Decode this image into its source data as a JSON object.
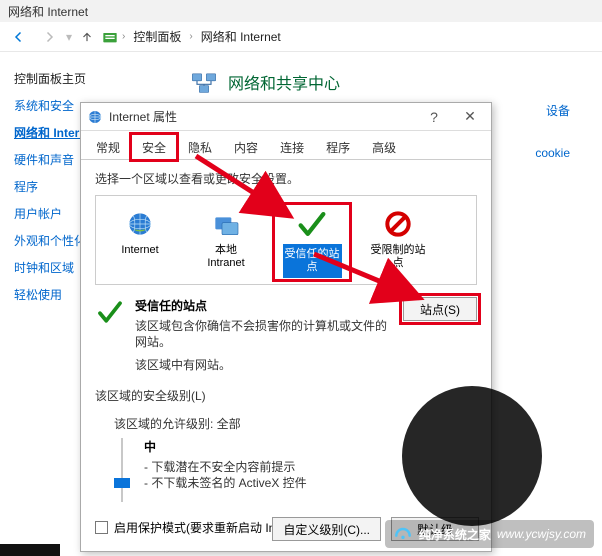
{
  "window": {
    "title": "网络和 Internet"
  },
  "breadcrumb": {
    "root": "控制面板",
    "current": "网络和 Internet"
  },
  "sideNav": {
    "heading": "控制面板主页",
    "items": [
      {
        "label": "系统和安全"
      },
      {
        "label": "网络和 Internet",
        "active": true
      },
      {
        "label": "硬件和声音"
      },
      {
        "label": "程序"
      },
      {
        "label": "用户帐户"
      },
      {
        "label": "外观和个性化"
      },
      {
        "label": "时钟和区域"
      },
      {
        "label": "轻松使用"
      }
    ]
  },
  "rightPane": {
    "categoryTitle": "网络和共享中心",
    "extraLinks": {
      "a": "设备",
      "b": "cookie"
    }
  },
  "dialog": {
    "title": "Internet 属性",
    "tabs": [
      "常规",
      "安全",
      "隐私",
      "内容",
      "连接",
      "程序",
      "高级"
    ],
    "activeTab": 1,
    "hint": "选择一个区域以查看或更改安全设置。",
    "zones": [
      {
        "name": "Internet"
      },
      {
        "name": "本地\nIntranet"
      },
      {
        "name": "受信任的站\n点",
        "selected": true
      },
      {
        "name": "受限制的站\n点"
      }
    ],
    "detail": {
      "title": "受信任的站点",
      "desc": "该区域包含你确信不会损害你的计算机或文件的网站。",
      "sub": "该区域中有网站。",
      "sitesBtn": "站点(S)"
    },
    "level": {
      "sectionTitle": "该区域的安全级别(L)",
      "allowed": "该区域的允许级别: 全部",
      "name": "中",
      "lines": [
        "- 下载潜在不安全内容前提示",
        "- 不下载未签名的 ActiveX 控件"
      ]
    },
    "protected": {
      "label": "启用保护模式(要求重新启动 Internet Explorer)(P)"
    },
    "buttons": {
      "custom": "自定义级别(C)...",
      "default": "默认级"
    }
  },
  "watermark": {
    "cn": "纯净系统之家",
    "url": "www.ycwjsy.com"
  }
}
